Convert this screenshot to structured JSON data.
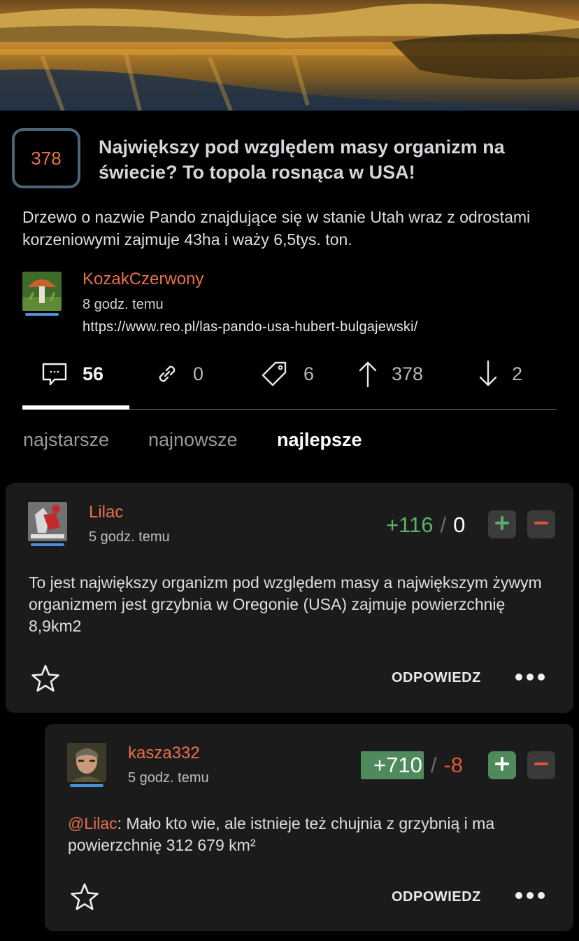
{
  "post": {
    "score": "378",
    "title": "Największy pod względem masy organizm na świecie? To topola rosnąca w USA!",
    "description": "Drzewo o nazwie Pando znajdujące się w stanie Utah wraz z odrostami korzeniowymi zajmuje 43ha i waży 6,5tys. ton.",
    "author": "KozakCzerwony",
    "time": "8 godz. temu",
    "url": "https://www.reo.pl/las-pando-usa-hubert-bulgajewski/"
  },
  "stats": {
    "comments": "56",
    "links": "0",
    "tags": "6",
    "upvotes": "378",
    "downvotes": "2"
  },
  "sort": {
    "oldest": "najstarsze",
    "newest": "najnowsze",
    "best": "najlepsze"
  },
  "comments": [
    {
      "author": "Lilac",
      "time": "5 godz. temu",
      "plus": "+116",
      "minus": "0",
      "text": "To jest największy organizm pod względem masy a największym żywym organizmem jest grzybnia w Oregonie (USA) zajmuje powierzchnię 8,9km2",
      "reply_label": "ODPOWIEDZ"
    },
    {
      "author": "kasza332",
      "time": "5 godz. temu",
      "plus": "+710",
      "minus": "-8",
      "mention": "@Lilac",
      "text": ": Mało kto wie, ale istnieje też chujnia z grzybnią i ma powierzchnię 312 679 km²",
      "reply_label": "ODPOWIEDZ"
    }
  ],
  "vote_sep": "/",
  "colors": {
    "accent": "#e8704a",
    "plus": "#58b06b",
    "minus": "#e0543a",
    "card": "#1b1b1b",
    "underline": "#4a90d9"
  }
}
